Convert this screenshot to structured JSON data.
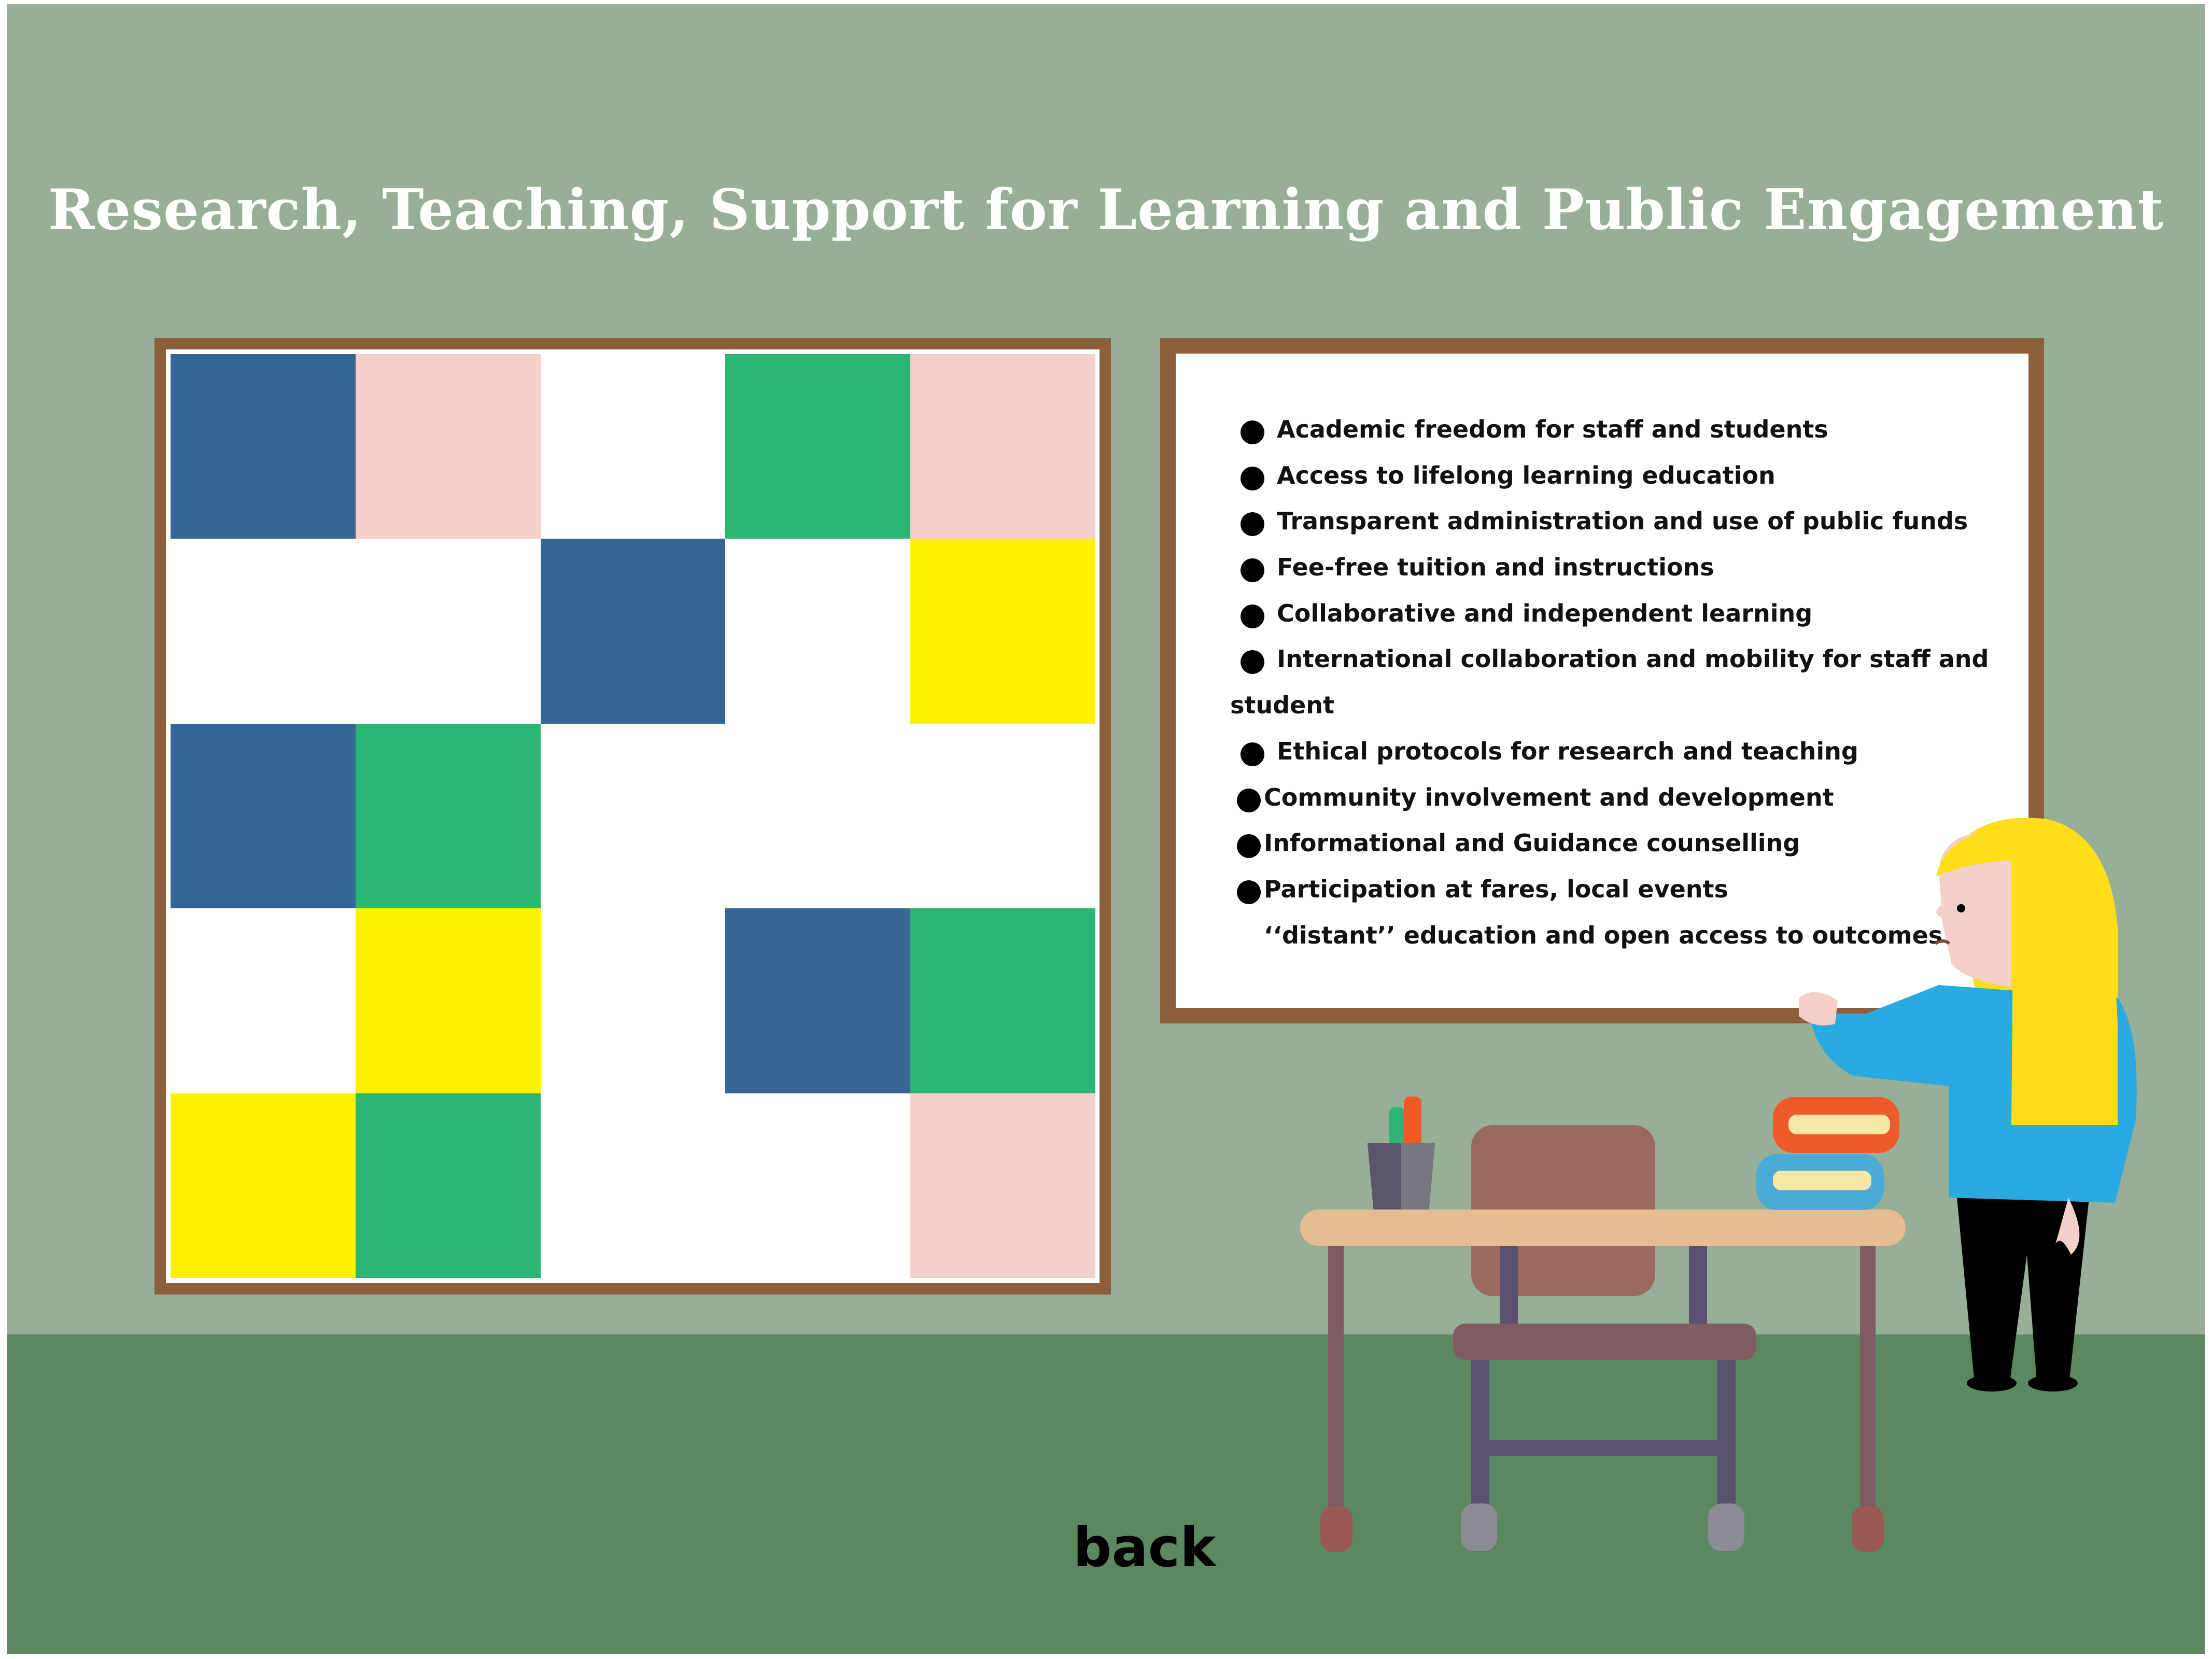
{
  "page": {
    "title": "Research, Teaching, Support for Learning and Public Engagement",
    "back_label": "back"
  },
  "colors": {
    "wall": "#97ae97",
    "floor": "#5b8860",
    "frame": "#8b5e3c",
    "blue": "#366794",
    "pink": "#f5d0c8",
    "green": "#2db673",
    "yellow": "#fef200",
    "white": "#ffffff"
  },
  "color_board": {
    "grid": [
      [
        "blue",
        "pink",
        "white",
        "green",
        "pink"
      ],
      [
        "white",
        "white",
        "blue",
        "white",
        "yellow"
      ],
      [
        "blue",
        "green",
        "white",
        "white",
        "white"
      ],
      [
        "white",
        "yellow",
        "white",
        "blue",
        "green"
      ],
      [
        "yellow",
        "green",
        "white",
        "white",
        "pink"
      ]
    ]
  },
  "text_board": {
    "items": [
      {
        "text": "Academic freedom for staff and students",
        "bullet": true
      },
      {
        "text": "Access to lifelong learning education",
        "bullet": true
      },
      {
        "text": "Transparent administration and use of public funds",
        "bullet": true
      },
      {
        "text": "Fee-free tuition and instructions",
        "bullet": true
      },
      {
        "text": "Collaborative and independent learning",
        "bullet": true
      },
      {
        "text": "International collaboration and mobility for staff and",
        "bullet": true
      },
      {
        "text": "student",
        "bullet": false,
        "continuation": true
      },
      {
        "text": "Ethical protocols for research and teaching",
        "bullet": true
      },
      {
        "text": "Community involvement and development",
        "bullet": true,
        "tight": true
      },
      {
        "text": "Informational and Guidance counselling",
        "bullet": true,
        "tight": true
      },
      {
        "text": "Participation at fares, local events",
        "bullet": true,
        "tight": true
      },
      {
        "text": "‘‘distant’’ education and open access to outcomes",
        "bullet": false
      }
    ]
  },
  "scene_objects": {
    "teacher": "teacher-illustration",
    "desk": "desk-illustration",
    "chair": "chair-illustration",
    "books": "book-stack-icon",
    "pencil_cup": "pencil-cup-icon"
  }
}
